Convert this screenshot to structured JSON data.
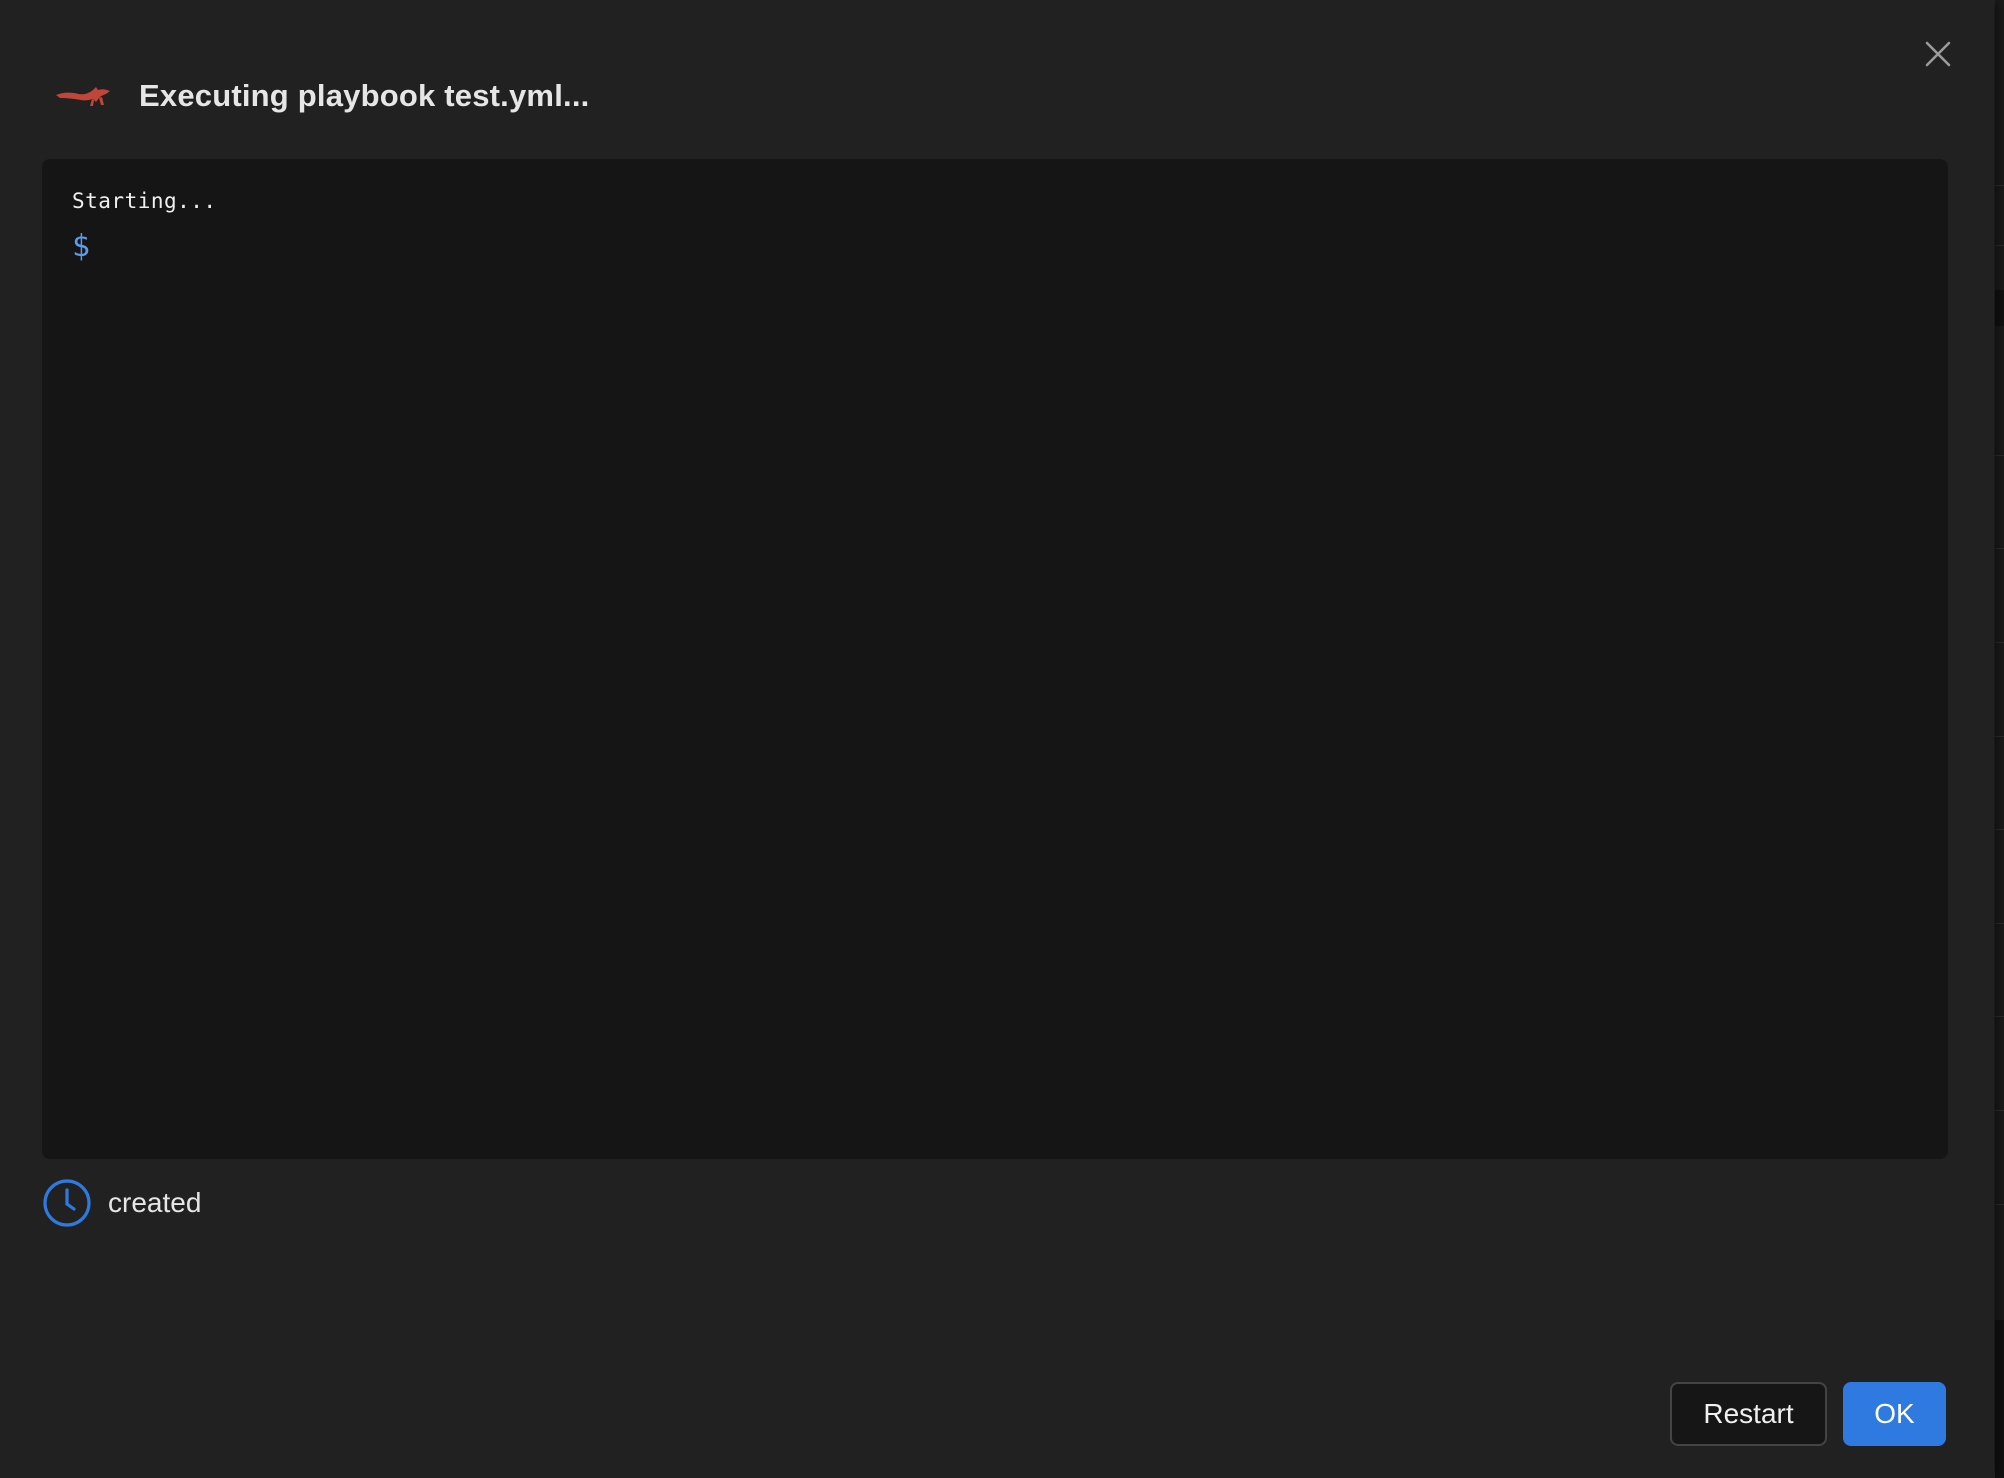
{
  "dialog": {
    "title": "Executing playbook test.yml...",
    "logo_icon": "red-fox-logo-icon",
    "close_icon": "close-icon"
  },
  "terminal": {
    "lines": [
      "Starting..."
    ],
    "prompt": "$"
  },
  "status": {
    "icon": "clock-icon",
    "label": "created"
  },
  "footer": {
    "restart_label": "Restart",
    "ok_label": "OK"
  },
  "colors": {
    "dialog_bg": "#212121",
    "terminal_bg": "#151515",
    "accent": "#2f7ae0",
    "prompt": "#5b9cf0",
    "logo": "#c0463a"
  }
}
